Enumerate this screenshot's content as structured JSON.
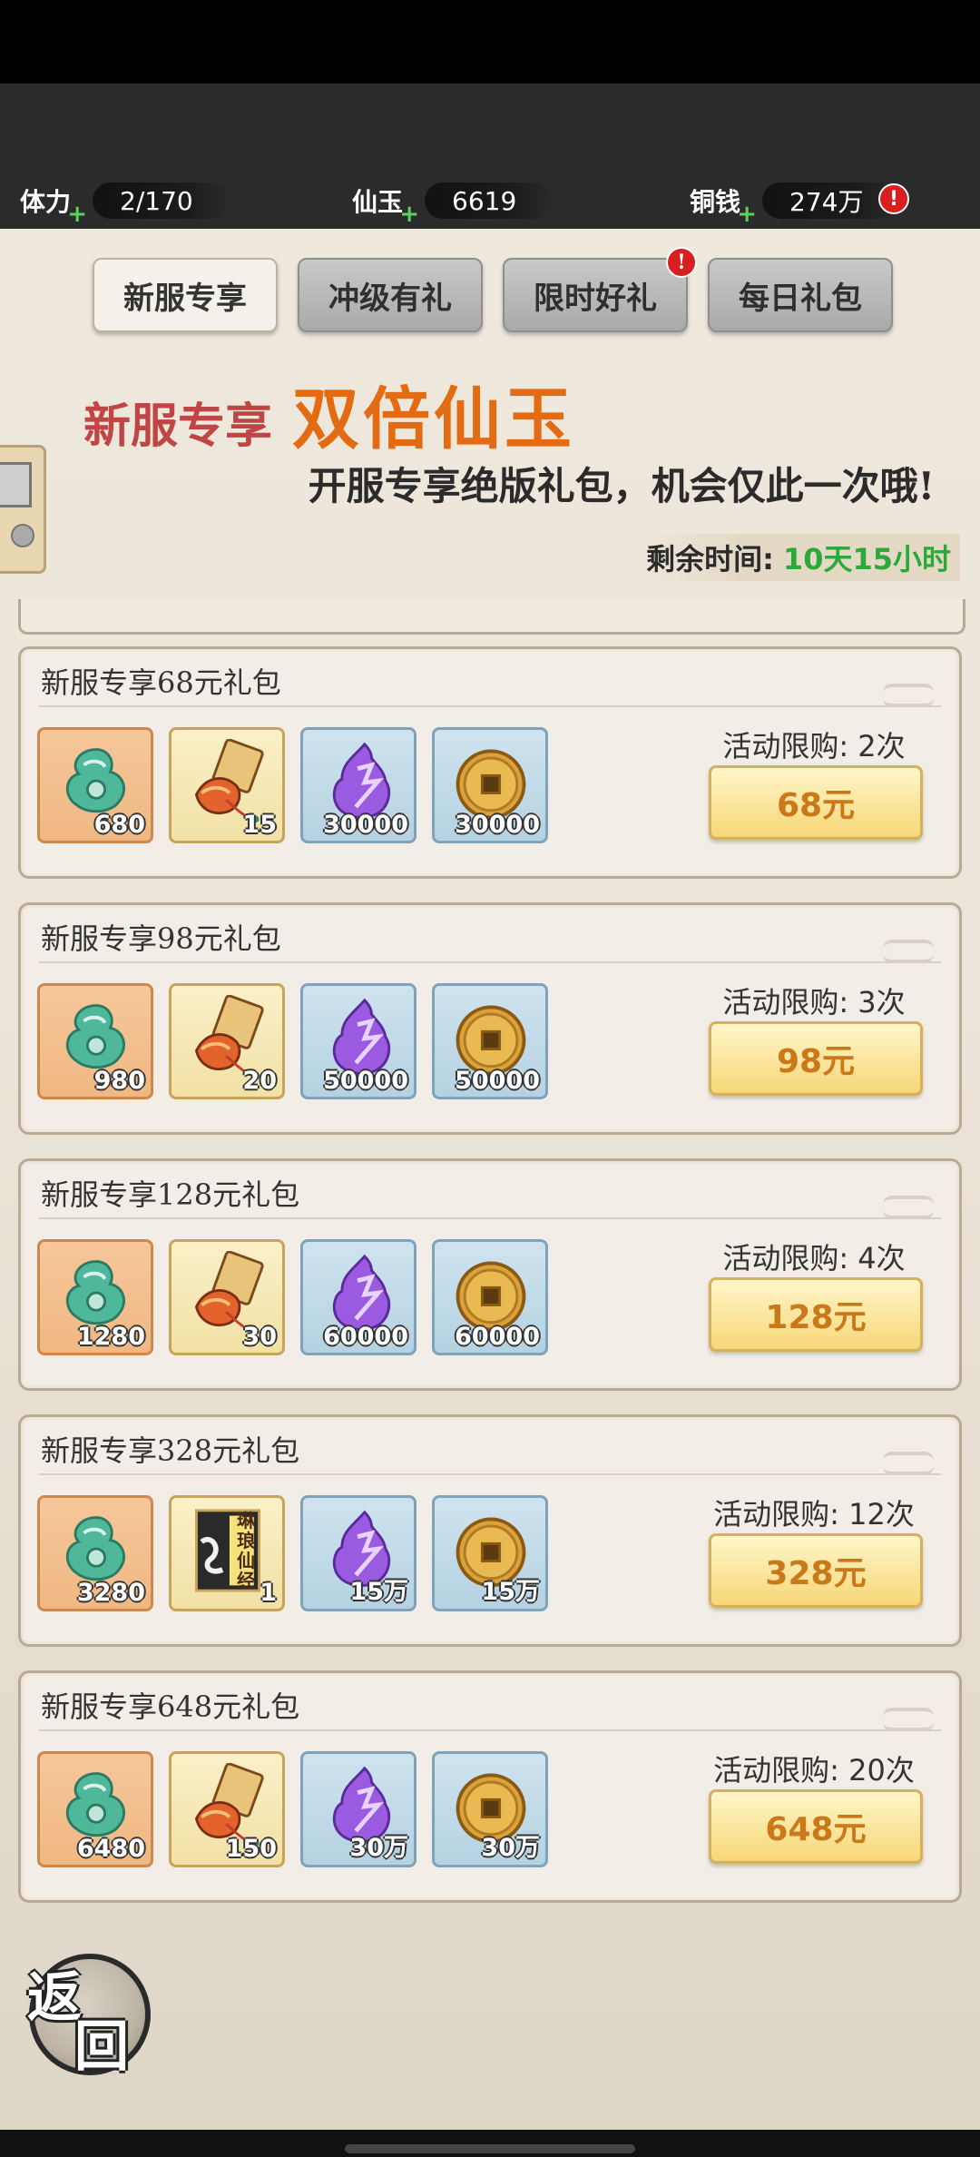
{
  "hud": {
    "stamina_label": "体力",
    "stamina_value": "2/170",
    "jade_label": "仙玉",
    "jade_value": "6619",
    "coin_label": "铜钱",
    "coin_value": "274万",
    "plus": "+",
    "alert": "!"
  },
  "tabs": [
    {
      "label": "新服专享",
      "active": true
    },
    {
      "label": "冲级有礼",
      "active": false
    },
    {
      "label": "限时好礼",
      "active": false,
      "alert": true
    },
    {
      "label": "每日礼包",
      "active": false
    }
  ],
  "banner": {
    "title_small": "新服专享",
    "title_big": "双倍仙玉",
    "subtitle": "开服专享绝版礼包，机会仅此一次哦!",
    "timer_label": "剩余时间:",
    "timer_value": "10天15小时"
  },
  "packs": [
    {
      "title": "新服专享68元礼包",
      "items": [
        "680",
        "15",
        "30000",
        "30000"
      ],
      "limit": "活动限购: 2次",
      "price": "68元"
    },
    {
      "title": "新服专享98元礼包",
      "items": [
        "980",
        "20",
        "50000",
        "50000"
      ],
      "limit": "活动限购: 3次",
      "price": "98元"
    },
    {
      "title": "新服专享128元礼包",
      "items": [
        "1280",
        "30",
        "60000",
        "60000"
      ],
      "limit": "活动限购: 4次",
      "price": "128元"
    },
    {
      "title": "新服专享328元礼包",
      "items": [
        "3280",
        "1",
        "15万",
        "15万"
      ],
      "limit": "活动限购: 12次",
      "price": "328元",
      "scroll_text": "琳琅仙经"
    },
    {
      "title": "新服专享648元礼包",
      "items": [
        "6480",
        "150",
        "30万",
        "30万"
      ],
      "limit": "活动限购: 20次",
      "price": "648元"
    }
  ],
  "back": {
    "char1": "返",
    "char2": "回"
  },
  "colors": {
    "timer_green": "#2ea83a",
    "price_orange": "#c9781a",
    "title_orange": "#e26b13",
    "title_red": "#c04646"
  }
}
